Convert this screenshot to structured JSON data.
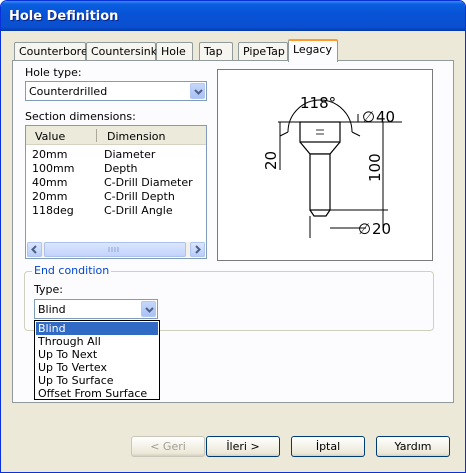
{
  "window": {
    "title": "Hole Definition"
  },
  "tabs": [
    {
      "label": "Counterbore"
    },
    {
      "label": "Countersink"
    },
    {
      "label": "Hole"
    },
    {
      "label": "Tap"
    },
    {
      "label": "PipeTap"
    },
    {
      "label": "Legacy",
      "active": true
    }
  ],
  "hole_type": {
    "label": "Hole type:",
    "value": "Counterdrilled"
  },
  "section_dimensions": {
    "label": "Section dimensions:",
    "columns": [
      "Value",
      "Dimension"
    ],
    "rows": [
      {
        "value": "20mm",
        "dimension": "Diameter"
      },
      {
        "value": "100mm",
        "dimension": "Depth"
      },
      {
        "value": "40mm",
        "dimension": "C-Drill Diameter"
      },
      {
        "value": "20mm",
        "dimension": "C-Drill Depth"
      },
      {
        "value": "118deg",
        "dimension": "C-Drill Angle"
      }
    ]
  },
  "preview": {
    "angle": "118°",
    "top_diameter": "40",
    "cdrill_depth": "20",
    "depth": "100",
    "bottom_diameter": "20",
    "diameter_symbol": "∅"
  },
  "end_condition": {
    "legend": "End condition",
    "type_label": "Type:",
    "value": "Blind",
    "options": [
      "Blind",
      "Through All",
      "Up To Next",
      "Up To Vertex",
      "Up To Surface",
      "Offset From Surface"
    ],
    "selected_index": 0
  },
  "buttons": {
    "back": "< Geri",
    "next": "İleri >",
    "cancel": "İptal",
    "help": "Yardım"
  },
  "colors": {
    "title_bar": "#0853d6",
    "selection": "#316ac5",
    "tab_highlight": "#ff9a2e"
  }
}
